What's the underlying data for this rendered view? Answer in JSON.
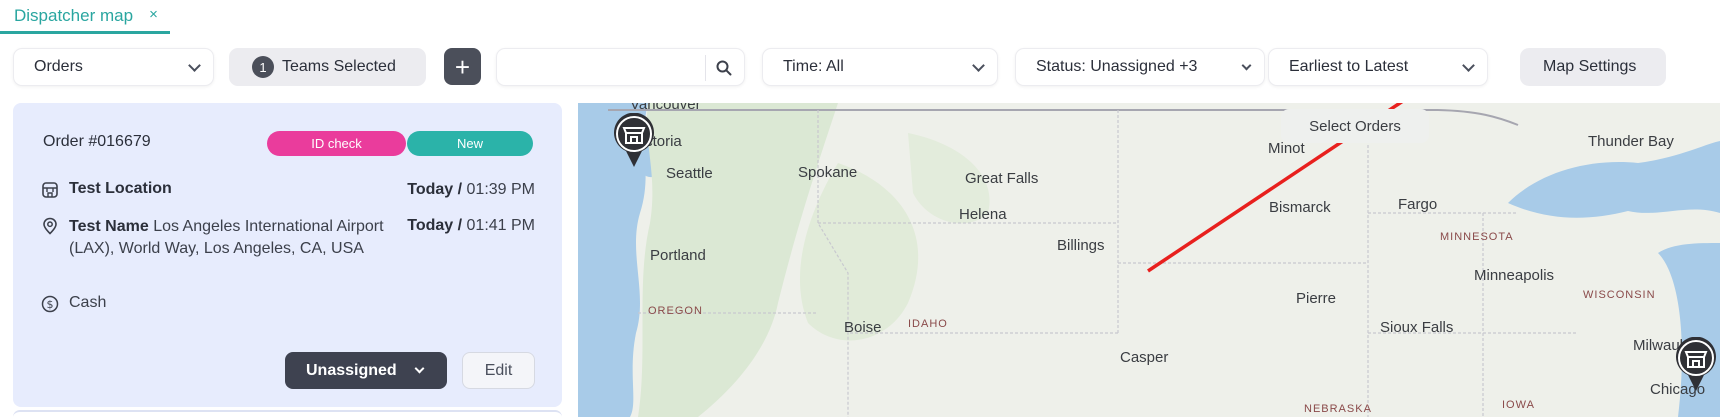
{
  "tab": {
    "title": "Dispatcher map",
    "close": "×"
  },
  "toolbar": {
    "orders_label": "Orders",
    "teams_count": "1",
    "teams_label": "Teams Selected",
    "add_label": "+",
    "search_value": "",
    "time_label": "Time: All",
    "status_label": "Status: Unassigned +3",
    "sort_label": "Earliest to Latest",
    "map_settings_label": "Map Settings"
  },
  "order": {
    "title": "Order #016679",
    "badge_id": "ID check",
    "badge_new": "New",
    "pickup": {
      "name": "Test Location",
      "date": "Today /",
      "time": "01:39 PM"
    },
    "dropoff": {
      "name": "Test Name",
      "address": "Los Angeles International Airport (LAX), World Way, Los Angeles, CA, USA",
      "date": "Today /",
      "time": "01:41 PM"
    },
    "payment": "Cash",
    "status_button": "Unassigned",
    "edit_button": "Edit"
  },
  "map": {
    "select_orders": "Select Orders",
    "cities": [
      "Vancouver",
      "Victoria",
      "Seattle",
      "Spokane",
      "Great Falls",
      "Helena",
      "Billings",
      "Portland",
      "Boise",
      "Casper",
      "Bismarck",
      "Minot",
      "Fargo",
      "Pierre",
      "Sioux Falls",
      "Minneapolis",
      "Thunder Bay",
      "Milwaukee",
      "Chicago"
    ],
    "states": [
      "OREGON",
      "IDAHO",
      "MINNESOTA",
      "WISCONSIN",
      "NEBRASKA",
      "IOWA"
    ]
  },
  "colors": {
    "accent": "#2aa6a0",
    "badge_id": "#ea3c9c",
    "badge_new": "#2bb3a9",
    "card_bg": "#e7ecfd",
    "arrow": "#e8201e"
  }
}
